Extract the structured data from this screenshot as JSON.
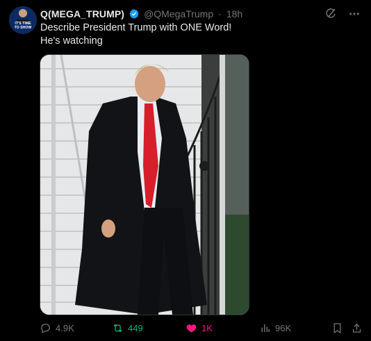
{
  "author": {
    "name": "Q(MEGA_TRUMP)",
    "handle": "@QMegaTrump",
    "separator": "·",
    "time": "18h",
    "avatar_text": [
      "IT'S TIME",
      "TO SHOW"
    ]
  },
  "post": {
    "lines": [
      "Describe President Trump with ONE Word!",
      "He's watching"
    ]
  },
  "header_icons": [
    "grok-icon",
    "more-icon"
  ],
  "stats": {
    "replies": "4.9K",
    "reposts": "449",
    "likes": "1K",
    "views": "96K"
  },
  "colors": {
    "background": "#000000",
    "text": "#e7e9ea",
    "muted": "#71767b",
    "verified": "#1d9bf0",
    "repost": "#00ba7c",
    "like": "#f91880"
  }
}
